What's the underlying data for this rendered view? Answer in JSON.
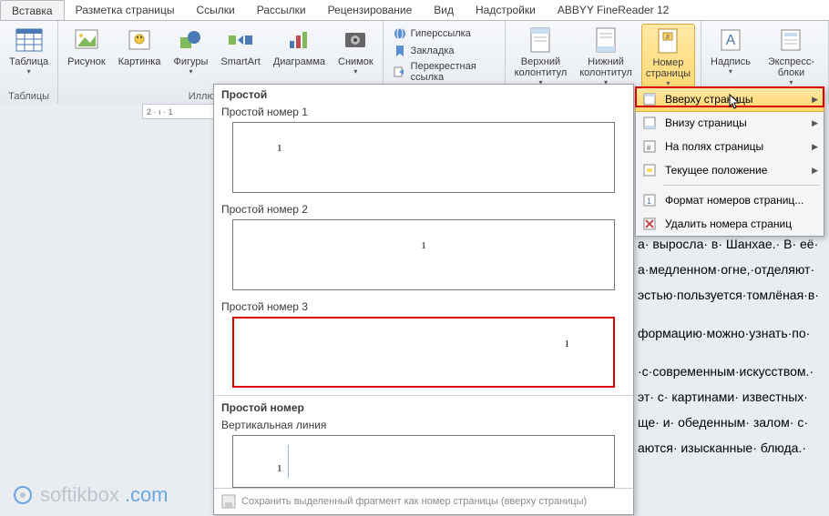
{
  "tabs": {
    "items": [
      "Вставка",
      "Разметка страницы",
      "Ссылки",
      "Рассылки",
      "Рецензирование",
      "Вид",
      "Надстройки",
      "ABBYY FineReader 12"
    ],
    "active_index": 0
  },
  "ribbon": {
    "groups": {
      "tables": {
        "label": "Таблицы",
        "table_btn": "Таблица"
      },
      "illustrations": {
        "label": "Иллюстрации",
        "picture": "Рисунок",
        "clipart": "Картинка",
        "shapes": "Фигуры",
        "smartart": "SmartArt",
        "chart": "Диаграмма",
        "screenshot": "Снимок"
      },
      "links": {
        "hyperlink": "Гиперссылка",
        "bookmark": "Закладка",
        "crossref": "Перекрестная ссылка"
      },
      "headerfooter": {
        "header": "Верхний\nколонтитул",
        "footer": "Нижний\nколонтитул",
        "pagenum": "Номер\nстраницы"
      },
      "text": {
        "textbox": "Надпись",
        "quickparts": "Экспресс-блоки"
      }
    }
  },
  "ruler": "2 · ı · 1",
  "gallery": {
    "cat1": "Простой",
    "opt1": "Простой номер 1",
    "opt2": "Простой номер 2",
    "opt3": "Простой номер 3",
    "cat2": "Простой номер",
    "opt4": "Вертикальная линия",
    "page_digit": "1",
    "footer": "Сохранить выделенный фрагмент как номер страницы (вверху страницы)"
  },
  "submenu": {
    "items": [
      {
        "label": "Вверху страницы",
        "arrow": true,
        "hl": true,
        "icon": "top"
      },
      {
        "label": "Внизу страницы",
        "arrow": true,
        "icon": "bottom"
      },
      {
        "label": "На полях страницы",
        "arrow": true,
        "icon": "margin"
      },
      {
        "label": "Текущее положение",
        "arrow": true,
        "icon": "current"
      },
      {
        "label": "Формат номеров страниц...",
        "arrow": false,
        "icon": "format"
      },
      {
        "label": "Удалить номера страниц",
        "arrow": false,
        "icon": "delete"
      }
    ]
  },
  "doc": {
    "p1": "а· выросла· в· Шанхае.· В· её· а·медленном·огне,·отделяют· эстью·пользуется·томлёная·в·",
    "p2": "формацию·можно·узнать·по·",
    "p3": "·с·современным·искусством.· эт· с· картинами· известных· ще· и· обеденным· залом· с· аются· изысканные· блюда.·"
  },
  "watermark": {
    "a": "softikbox",
    "b": ".com"
  }
}
